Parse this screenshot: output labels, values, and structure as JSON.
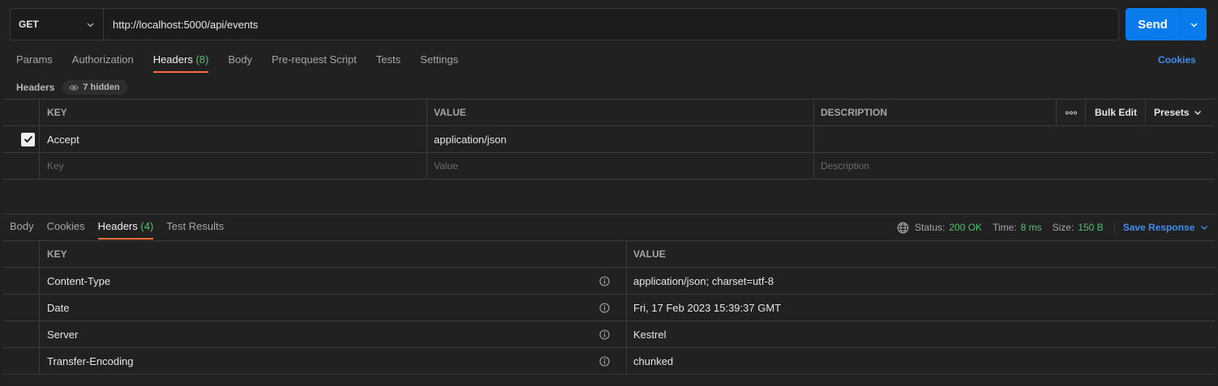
{
  "request": {
    "method": "GET",
    "url": "http://localhost:5000/api/events",
    "send_label": "Send"
  },
  "request_tabs": [
    {
      "label": "Params"
    },
    {
      "label": "Authorization"
    },
    {
      "label": "Headers",
      "count": "(8)"
    },
    {
      "label": "Body"
    },
    {
      "label": "Pre-request Script"
    },
    {
      "label": "Tests"
    },
    {
      "label": "Settings"
    }
  ],
  "cookies_link": "Cookies",
  "headers_section": {
    "title": "Headers",
    "hidden_label": "7 hidden",
    "columns": {
      "key": "KEY",
      "value": "VALUE",
      "description": "DESCRIPTION"
    },
    "bulk_edit": "Bulk Edit",
    "presets": "Presets",
    "rows": [
      {
        "checked": true,
        "key": "Accept",
        "value": "application/json",
        "description": ""
      }
    ],
    "placeholders": {
      "key": "Key",
      "value": "Value",
      "description": "Description"
    }
  },
  "response_tabs": [
    {
      "label": "Body"
    },
    {
      "label": "Cookies"
    },
    {
      "label": "Headers",
      "count": "(4)"
    },
    {
      "label": "Test Results"
    }
  ],
  "response_status": {
    "status_label": "Status:",
    "status_value": "200 OK",
    "time_label": "Time:",
    "time_value": "8 ms",
    "size_label": "Size:",
    "size_value": "150 B",
    "save_label": "Save Response"
  },
  "response_headers": {
    "columns": {
      "key": "KEY",
      "value": "VALUE"
    },
    "rows": [
      {
        "key": "Content-Type",
        "value": "application/json; charset=utf-8"
      },
      {
        "key": "Date",
        "value": "Fri, 17 Feb 2023 15:39:37 GMT"
      },
      {
        "key": "Server",
        "value": "Kestrel"
      },
      {
        "key": "Transfer-Encoding",
        "value": "chunked"
      }
    ]
  },
  "colors": {
    "accent_orange": "#ff6c37",
    "send_blue": "#097bed",
    "success_green": "#4ec26c",
    "link_blue": "#3d8ef0"
  }
}
